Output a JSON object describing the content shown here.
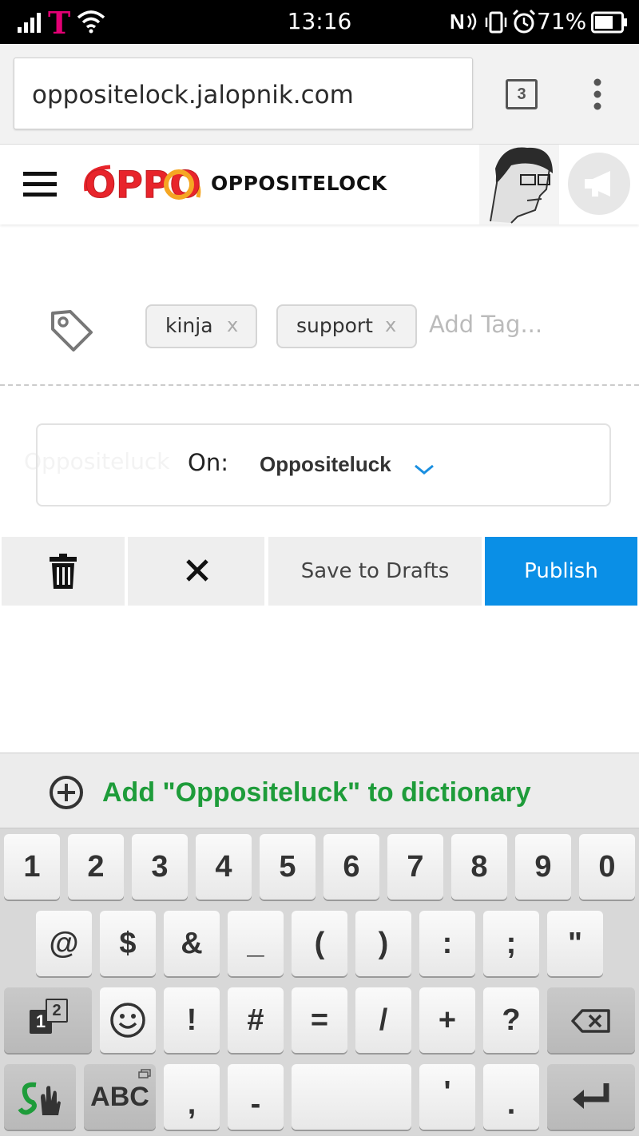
{
  "status_bar": {
    "time": "13:16",
    "battery": "71%"
  },
  "browser": {
    "url": "oppositelock.jalopnik.com",
    "tab_count": "3"
  },
  "site": {
    "brand": "OPPOSITELOCK",
    "logo_text": "OPPO"
  },
  "tags": {
    "items": [
      {
        "label": "kinja"
      },
      {
        "label": "support"
      }
    ],
    "remove_symbol": "x",
    "add_placeholder": "Add Tag..."
  },
  "publish_on": {
    "label": "On:",
    "value": "Oppositeluck",
    "ghost": "Oppositeluck"
  },
  "actions": {
    "save_label": "Save to Drafts",
    "publish_label": "Publish"
  },
  "keyboard": {
    "suggestion": "Add \"Oppositeluck\" to dictionary",
    "row1": [
      "1",
      "2",
      "3",
      "4",
      "5",
      "6",
      "7",
      "8",
      "9",
      "0"
    ],
    "row2": [
      "@",
      "$",
      "&",
      "_",
      "(",
      ")",
      ":",
      ";",
      "\""
    ],
    "row3": [
      "!",
      "#",
      "=",
      "/",
      "+",
      "?"
    ],
    "row4": {
      "abc": "ABC",
      "comma": ",",
      "dash": "-",
      "apostrophe": "'",
      "period": "."
    },
    "layout_key_main": "1",
    "layout_key_sup": "2"
  },
  "colors": {
    "publish": "#0a8fe6",
    "suggestion": "#1e9c3a"
  }
}
